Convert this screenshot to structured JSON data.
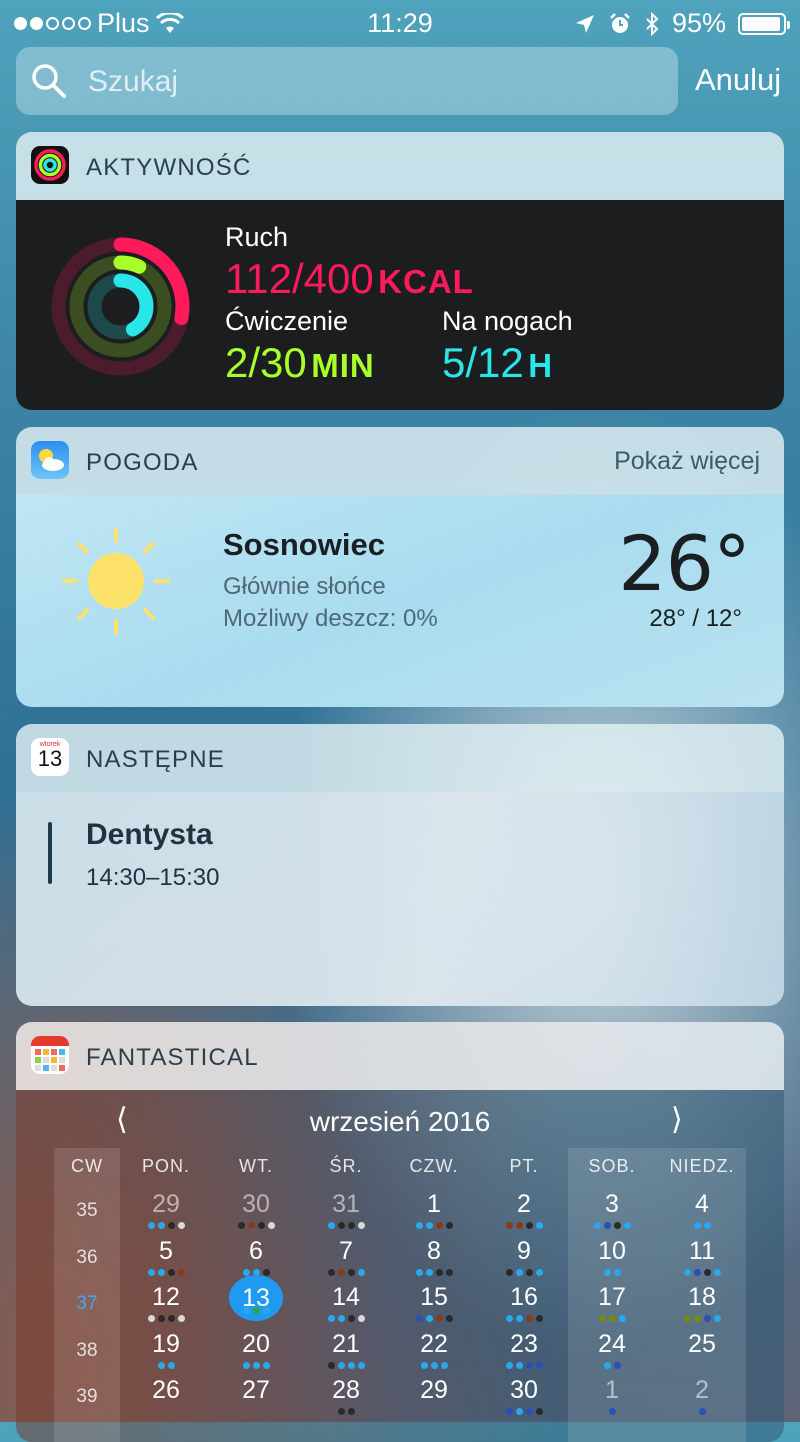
{
  "status": {
    "carrier": "Plus",
    "time": "11:29",
    "battery": "95%",
    "battery_level": 0.95,
    "signal_bars": 2
  },
  "search": {
    "placeholder": "Szukaj",
    "cancel_label": "Anuluj"
  },
  "activity": {
    "title": "AKTYWNOŚĆ",
    "move": {
      "label": "Ruch",
      "value": "112/400",
      "unit": "KCAL",
      "color": "#ff1a5a",
      "progress": 0.28
    },
    "exercise": {
      "label": "Ćwiczenie",
      "value": "2/30",
      "unit": "MIN",
      "color": "#a8ff2a",
      "progress": 0.07
    },
    "stand": {
      "label": "Na nogach",
      "value": "5/12",
      "unit": "H",
      "color": "#29e6e8",
      "progress": 0.42
    }
  },
  "weather": {
    "title": "POGODA",
    "more_label": "Pokaż więcej",
    "city": "Sosnowiec",
    "condition": "Głównie słońce",
    "rain": "Możliwy deszcz: 0%",
    "temp": "26°",
    "range": "28° / 12°",
    "icon": "sun-icon"
  },
  "next": {
    "title": "NASTĘPNE",
    "icon_day": "13",
    "icon_weekday": "wtorek",
    "event_title": "Dentysta",
    "event_time": "14:30–15:30"
  },
  "fantastical": {
    "title": "FANTASTICAL",
    "month": "wrzesień 2016",
    "prev": "⟨",
    "next": "⟩",
    "headers": [
      "CW",
      "PON.",
      "WT.",
      "ŚR.",
      "CZW.",
      "PT.",
      "SOB.",
      "NIEDZ."
    ],
    "weeks": [
      {
        "cw": "35",
        "days": [
          "29",
          "30",
          "31",
          "1",
          "2",
          "3",
          "4"
        ],
        "dim": [
          true,
          true,
          true,
          false,
          false,
          false,
          false
        ]
      },
      {
        "cw": "36",
        "days": [
          "5",
          "6",
          "7",
          "8",
          "9",
          "10",
          "11"
        ],
        "dim": [
          false,
          false,
          false,
          false,
          false,
          false,
          false
        ]
      },
      {
        "cw": "37",
        "days": [
          "12",
          "13",
          "14",
          "15",
          "16",
          "17",
          "18"
        ],
        "dim": [
          false,
          false,
          false,
          false,
          false,
          false,
          false
        ],
        "current": true
      },
      {
        "cw": "38",
        "days": [
          "19",
          "20",
          "21",
          "22",
          "23",
          "24",
          "25"
        ],
        "dim": [
          false,
          false,
          false,
          false,
          false,
          false,
          false
        ]
      },
      {
        "cw": "39",
        "days": [
          "26",
          "27",
          "28",
          "29",
          "30",
          "1",
          "2"
        ],
        "dim": [
          false,
          false,
          false,
          false,
          false,
          true,
          true
        ]
      }
    ],
    "today": "13",
    "dot_colors": {
      "b": "#2aa8ee",
      "k": "#2a2a2a",
      "r": "#8a3a1a",
      "w": "#d8d8d8",
      "n": "#2a4fb8",
      "g": "#2aa848",
      "o": "#7a8a10"
    },
    "dots": [
      [
        "bbkw",
        "krkw",
        "bkkw",
        "bbrk",
        "rrkb",
        "bnkb",
        "bb"
      ],
      [
        "bbkr",
        "bbk",
        "krkb",
        "bbkk",
        "kbkb",
        "bb",
        "bnkb"
      ],
      [
        "wkkw",
        "bgb",
        "bbkw",
        "nbrk",
        "bbrk",
        "oob",
        "oonb"
      ],
      [
        "bb",
        "bbb",
        "kbbb",
        "bbb",
        "bbnn",
        "bn",
        ""
      ],
      [
        "",
        "",
        "kk",
        "",
        "nbnk",
        "n",
        "n"
      ]
    ]
  }
}
